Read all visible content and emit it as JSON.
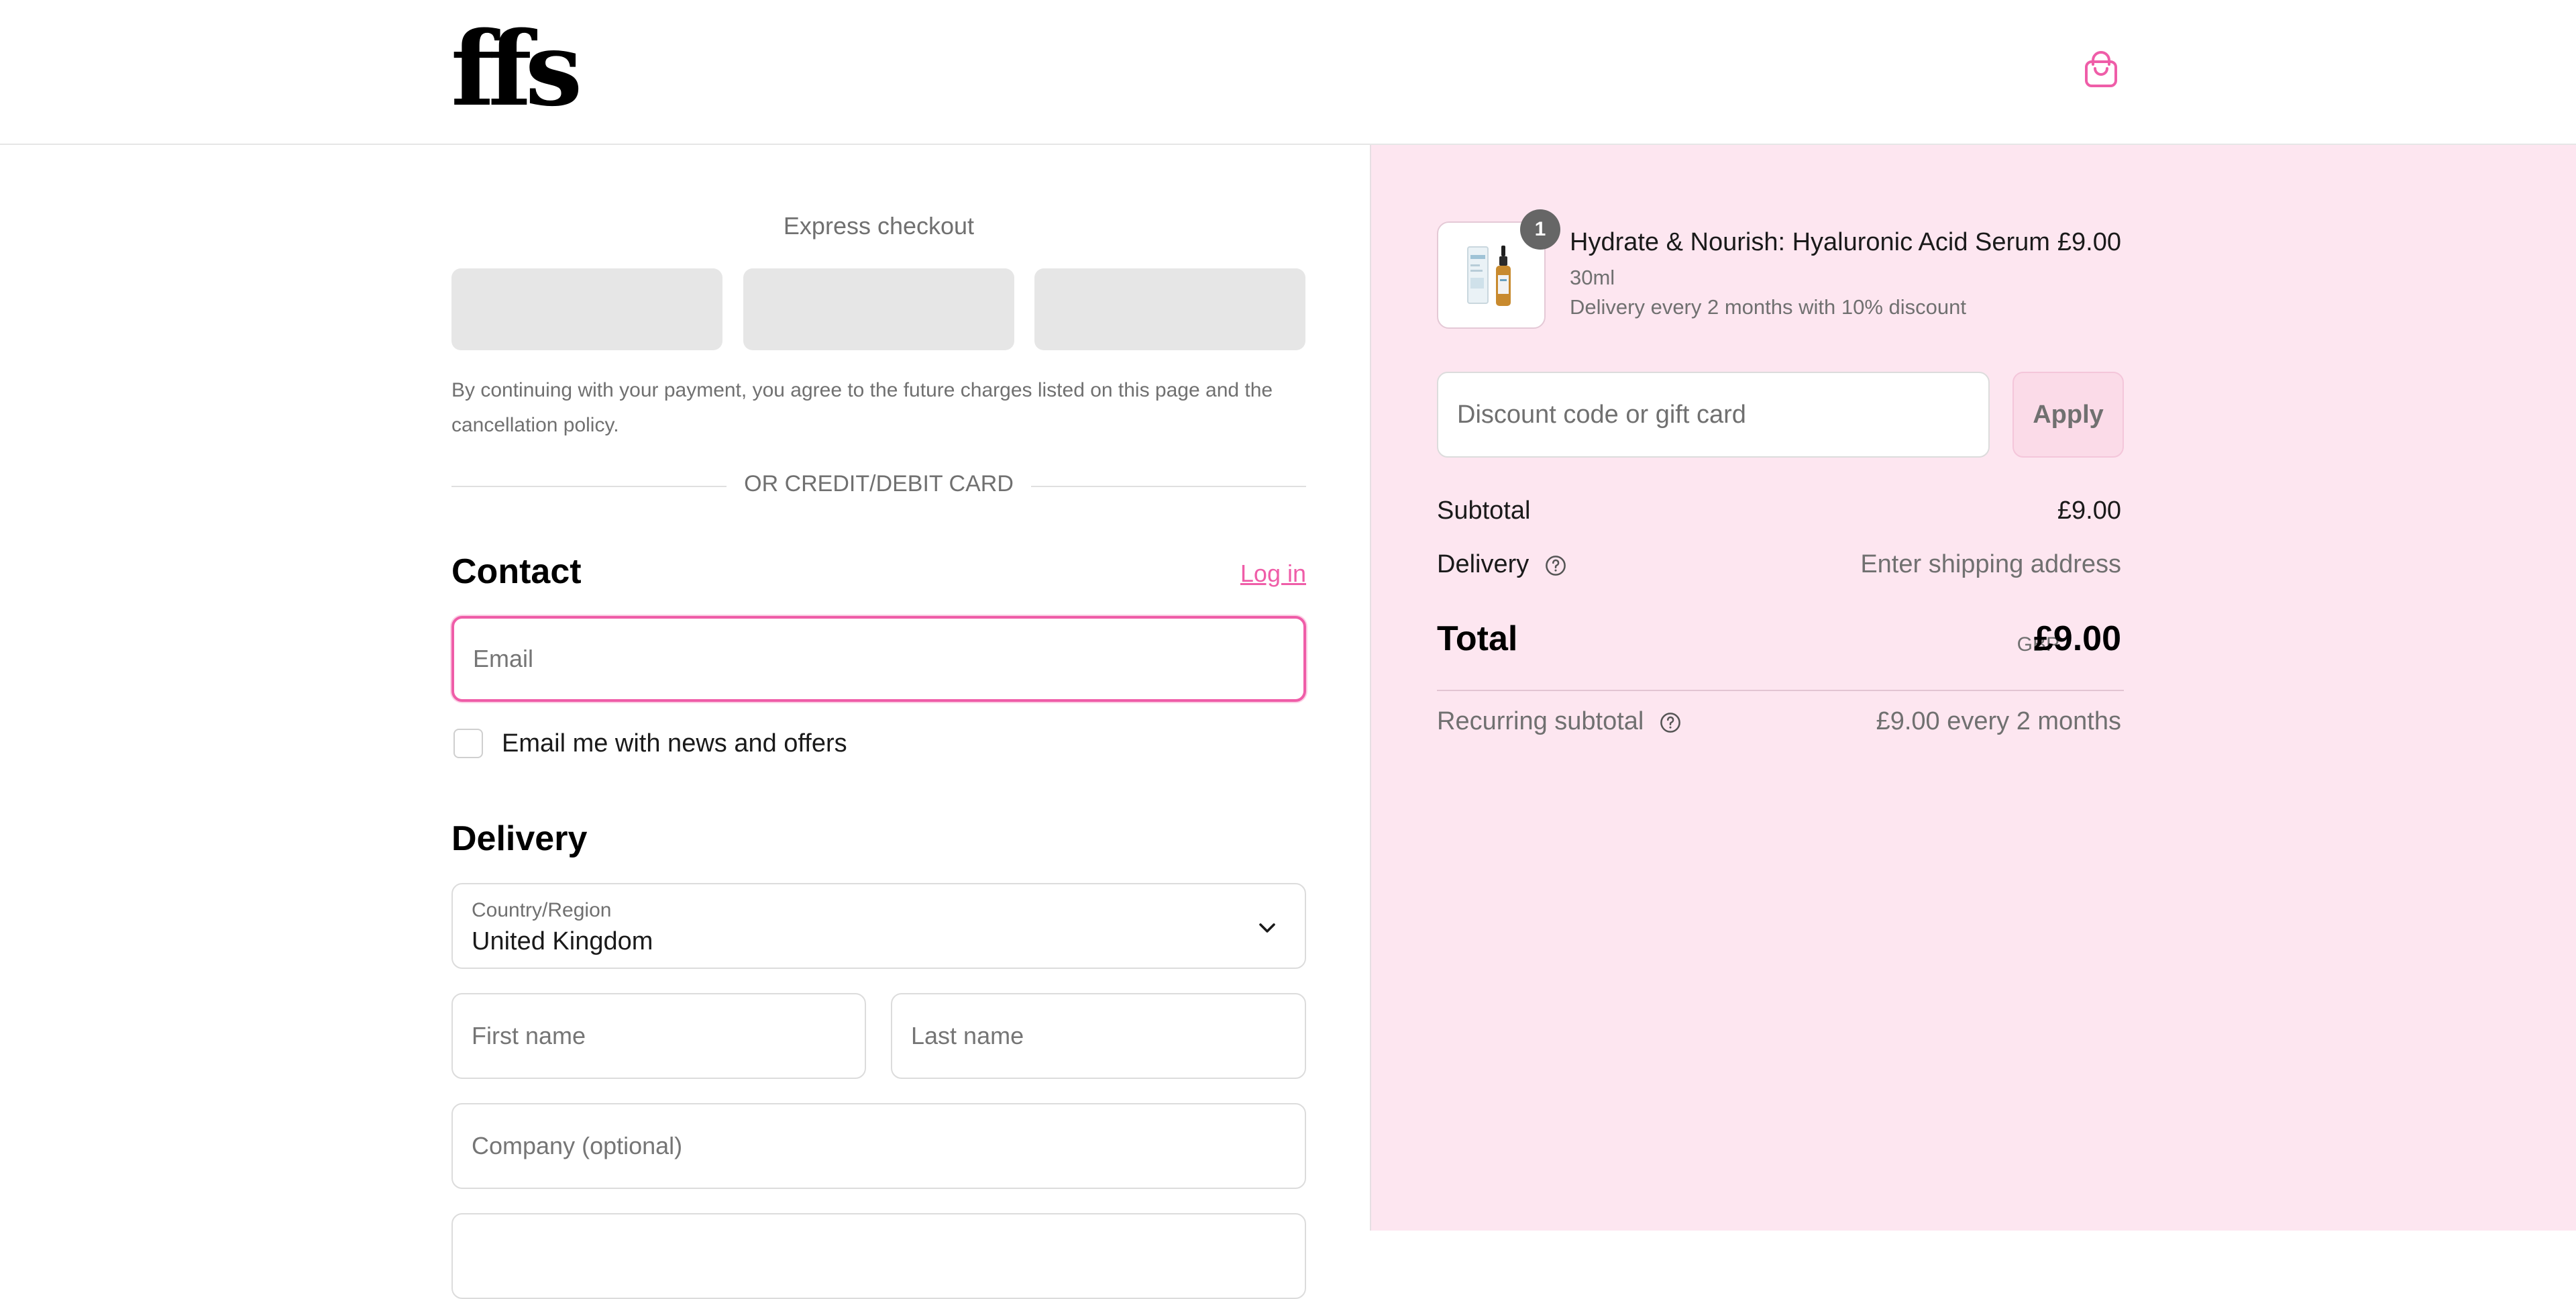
{
  "header": {
    "logo_text": "ffs",
    "cart_icon": "shopping-bag-icon",
    "accent": "#ef5da8"
  },
  "express": {
    "title": "Express checkout",
    "legal": "By continuing with your payment, you agree to the future charges listed on this page and the cancellation policy.",
    "divider": "OR CREDIT/DEBIT CARD"
  },
  "contact": {
    "title": "Contact",
    "login_label": "Log in",
    "email_placeholder": "Email",
    "newsletter_label": "Email me with news and offers"
  },
  "delivery": {
    "title": "Delivery",
    "country_label": "Country/Region",
    "country_value": "United Kingdom",
    "first_name_placeholder": "First name",
    "last_name_placeholder": "Last name",
    "company_placeholder": "Company (optional)"
  },
  "summary": {
    "background": "#fde6f0",
    "item": {
      "quantity": "1",
      "name": "Hydrate & Nourish: Hyaluronic Acid Serum",
      "variant": "30ml",
      "plan": "Delivery every 2 months with 10% discount",
      "price": "£9.00"
    },
    "discount_placeholder": "Discount code or gift card",
    "apply_label": "Apply",
    "subtotal_label": "Subtotal",
    "subtotal_value": "£9.00",
    "delivery_label": "Delivery",
    "delivery_value": "Enter shipping address",
    "total_label": "Total",
    "total_currency": "GBP",
    "total_value": "£9.00",
    "recurring_label": "Recurring subtotal",
    "recurring_value": "£9.00 every 2 months"
  }
}
